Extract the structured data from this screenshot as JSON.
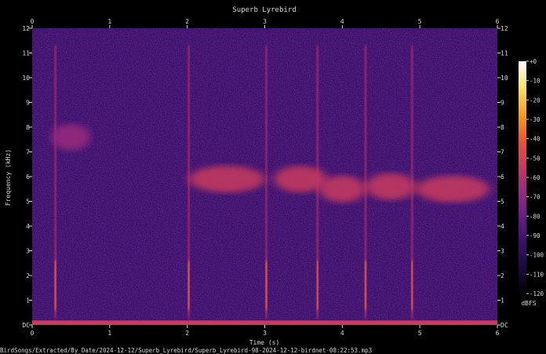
{
  "chart_data": {
    "type": "heatmap",
    "title": "Superb Lyrebird",
    "xlabel": "Time (s)",
    "ylabel": "Frequency (kHz)",
    "xlim": [
      0,
      6.0
    ],
    "ylim": [
      0,
      12
    ],
    "x_ticks": [
      "0",
      "1",
      "2",
      "3",
      "4",
      "5",
      "6"
    ],
    "y_ticks": [
      "DC",
      "1",
      "2",
      "3",
      "4",
      "5",
      "6",
      "7",
      "8",
      "9",
      "10",
      "11",
      "12"
    ],
    "colorbar": {
      "label": "dBFS",
      "ticks": [
        "+0",
        "-10",
        "-20",
        "-30",
        "-40",
        "-50",
        "-60",
        "-70",
        "-80",
        "-90",
        "-100",
        "-110",
        "-120"
      ],
      "range": [
        -120,
        0
      ],
      "colormap": [
        "#000000",
        "#1a0b40",
        "#3a0f6e",
        "#6a1c8a",
        "#9b2a7e",
        "#c93a5e",
        "#ec5a30",
        "#f9a420",
        "#fde26a",
        "#ffffff"
      ]
    },
    "background_level_dbfs": -95,
    "dc_band_level_dbfs": -55,
    "events": [
      {
        "name": "song-phrase-1",
        "t_start": 2.02,
        "t_end": 3.0,
        "f_center_khz": 5.9,
        "level_dbfs": -52
      },
      {
        "name": "song-phrase-2",
        "t_start": 3.12,
        "t_end": 3.8,
        "f_center_khz": 5.9,
        "level_dbfs": -52
      },
      {
        "name": "song-phrase-3",
        "t_start": 3.7,
        "t_end": 4.3,
        "f_center_khz": 5.5,
        "level_dbfs": -55
      },
      {
        "name": "song-phrase-4",
        "t_start": 4.3,
        "t_end": 4.95,
        "f_center_khz": 5.6,
        "level_dbfs": -52
      },
      {
        "name": "song-phrase-5",
        "t_start": 4.95,
        "t_end": 5.9,
        "f_center_khz": 5.5,
        "level_dbfs": -55
      },
      {
        "name": "early-call",
        "t_start": 0.25,
        "t_end": 0.75,
        "f_center_khz": 7.6,
        "level_dbfs": -70
      }
    ],
    "onsets_s": [
      0.3,
      2.02,
      3.02,
      3.68,
      4.3,
      4.9
    ]
  },
  "footer_path": "BirdSongs/Extracted/By_Date/2024-12-12/Superb_Lyrebird/Superb_Lyrebird-98-2024-12-12-birdnet-08:22:53.mp3"
}
